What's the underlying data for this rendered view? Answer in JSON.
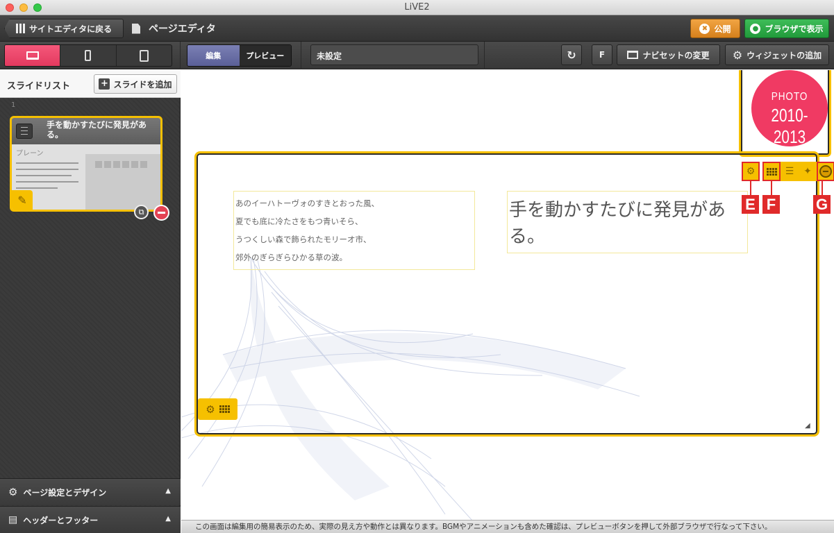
{
  "window": {
    "title": "LiVE2"
  },
  "header": {
    "back_label": "サイトエディタに戻る",
    "page_title": "ページエディタ",
    "publish_label": "公開",
    "browser_label": "ブラウザで表示"
  },
  "toolbar": {
    "devices": [
      "laptop",
      "phone",
      "tablet"
    ],
    "active_device": "laptop",
    "mode_edit": "編集",
    "mode_preview": "プレビュー",
    "page_name": "未設定",
    "f_label": "F",
    "nav_label": "ナビセットの変更",
    "widget_label": "ウィジェットの追加"
  },
  "sidebar": {
    "title": "スライドリスト",
    "add_slide_label": "スライドを追加",
    "slides": [
      {
        "number": "1",
        "title": "手を動かすたびに発見がある。",
        "layout": "プレーン"
      }
    ],
    "page_settings_label": "ページ設定とデザイン",
    "header_footer_label": "ヘッダーとフッター"
  },
  "canvas": {
    "photo_badge_line1": "PHOTO",
    "photo_badge_line2": "2010-2013",
    "body_lines": [
      "あのイーハトーヴォのすきとおった風、",
      "夏でも底に冷たさをもつ青いそら、",
      "うつくしい森で飾られたモリーオ市、",
      "郊外のぎらぎらひかる草の波。"
    ],
    "heading_text": "手を動かすたびに発見がある。",
    "callouts": [
      "E",
      "F",
      "G"
    ]
  },
  "status": {
    "message": "この画面は編集用の簡易表示のため、実際の見え方や動作とは異なります。BGMやアニメーションも含めた確認は、プレビューボタンを押して外部ブラウザで行なって下さい。"
  },
  "colors": {
    "active_device": "#e8466a",
    "widget_border": "#f6c000",
    "publish": "#e38f2a",
    "browser": "#2aa546",
    "photo_badge": "#f03a63",
    "callout": "#e02a2a"
  }
}
